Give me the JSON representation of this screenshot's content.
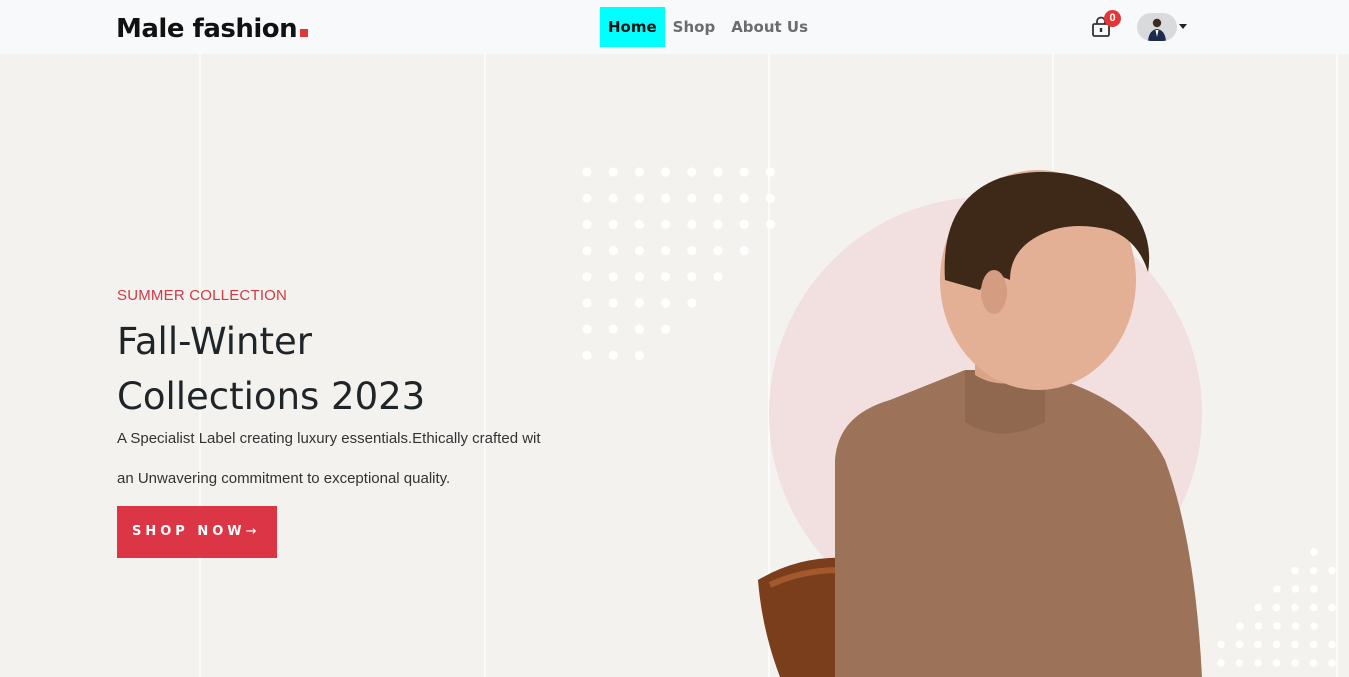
{
  "brand": {
    "name": "Male fashion"
  },
  "nav": {
    "links": [
      {
        "label": "Home",
        "active": true
      },
      {
        "label": "Shop",
        "active": false
      },
      {
        "label": "About Us",
        "active": false
      }
    ],
    "cart": {
      "icon": "lock-bag-icon",
      "count": "0"
    },
    "user": {
      "icon": "avatar",
      "menu": "caret-down-icon"
    }
  },
  "hero": {
    "subtitle": "SUMMER COLLECTION",
    "title_line1": "Fall-Winter",
    "title_line2": "Collections 2023",
    "desc_line1": "A Specialist Label creating luxury essentials.Ethically crafted wit",
    "desc_line2": "an Unwavering commitment to exceptional quality.",
    "button": {
      "label": "SHOP NOW",
      "arrow": "→"
    }
  },
  "colors": {
    "accent": "#dc3545",
    "active_nav": "#00ffff",
    "background": "#f3f2ee",
    "navbar": "#f8f9fa"
  }
}
